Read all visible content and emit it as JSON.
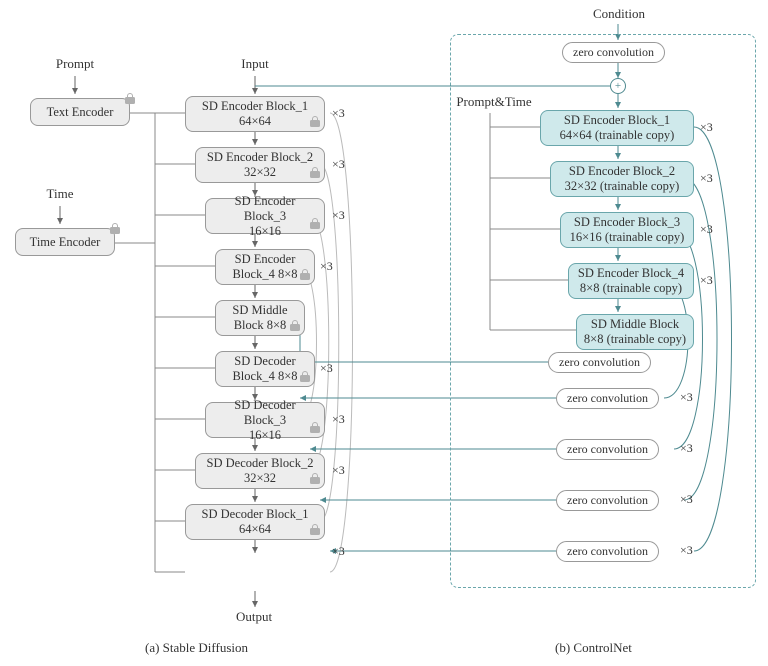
{
  "labels": {
    "prompt": "Prompt",
    "time": "Time",
    "input": "Input",
    "output": "Output",
    "condition": "Condition",
    "prompt_time": "Prompt&Time"
  },
  "sd": {
    "text_encoder": "Text Encoder",
    "time_encoder": "Time Encoder",
    "enc1": {
      "l1": "SD Encoder Block_1",
      "l2": "64×64"
    },
    "enc2": {
      "l1": "SD Encoder Block_2",
      "l2": "32×32"
    },
    "enc3": {
      "l1": "SD Encoder Block_3",
      "l2": "16×16"
    },
    "enc4": {
      "l1": "SD Encoder",
      "l2": "Block_4 8×8"
    },
    "mid": {
      "l1": "SD Middle",
      "l2": "Block 8×8"
    },
    "dec4": {
      "l1": "SD Decoder",
      "l2": "Block_4 8×8"
    },
    "dec3": {
      "l1": "SD Decoder Block_3",
      "l2": "16×16"
    },
    "dec2": {
      "l1": "SD Decoder Block_2",
      "l2": "32×32"
    },
    "dec1": {
      "l1": "SD Decoder Block_1",
      "l2": "64×64"
    }
  },
  "cn": {
    "zero_conv": "zero convolution",
    "enc1": {
      "l1": "SD Encoder Block_1",
      "l2": "64×64 (trainable copy)"
    },
    "enc2": {
      "l1": "SD Encoder Block_2",
      "l2": "32×32 (trainable copy)"
    },
    "enc3": {
      "l1": "SD Encoder Block_3",
      "l2": "16×16 (trainable copy)"
    },
    "enc4": {
      "l1": "SD Encoder Block_4",
      "l2": "8×8 (trainable copy)"
    },
    "mid": {
      "l1": "SD Middle Block",
      "l2": "8×8 (trainable copy)"
    }
  },
  "mult": "×3",
  "captions": {
    "a": "(a) Stable Diffusion",
    "b": "(b) ControlNet"
  }
}
